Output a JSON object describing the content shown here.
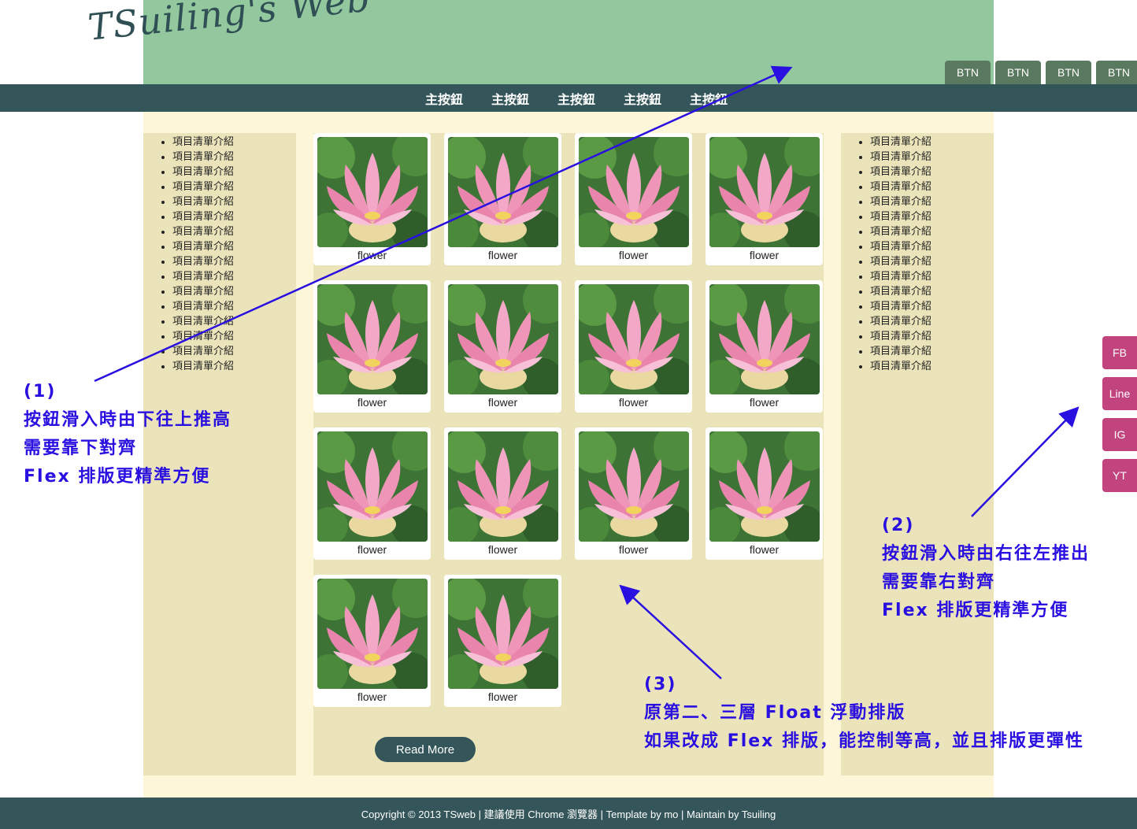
{
  "header": {
    "logo_text": "TSuiling's Web",
    "top_buttons": [
      "BTN",
      "BTN",
      "BTN",
      "BTN"
    ]
  },
  "nav": {
    "items": [
      "主按鈕",
      "主按鈕",
      "主按鈕",
      "主按鈕",
      "主按鈕"
    ]
  },
  "sidebar_left": {
    "items": [
      "項目清單介紹",
      "項目清單介紹",
      "項目清單介紹",
      "項目清單介紹",
      "項目清單介紹",
      "項目清單介紹",
      "項目清單介紹",
      "項目清單介紹",
      "項目清單介紹",
      "項目清單介紹",
      "項目清單介紹",
      "項目清單介紹",
      "項目清單介紹",
      "項目清單介紹",
      "項目清單介紹",
      "項目清單介紹"
    ]
  },
  "sidebar_right": {
    "items": [
      "項目清單介紹",
      "項目清單介紹",
      "項目清單介紹",
      "項目清單介紹",
      "項目清單介紹",
      "項目清單介紹",
      "項目清單介紹",
      "項目清單介紹",
      "項目清單介紹",
      "項目清單介紹",
      "項目清單介紹",
      "項目清單介紹",
      "項目清單介紹",
      "項目清單介紹",
      "項目清單介紹",
      "項目清單介紹"
    ]
  },
  "gallery": {
    "captions": [
      "flower",
      "flower",
      "flower",
      "flower",
      "flower",
      "flower",
      "flower",
      "flower",
      "flower",
      "flower",
      "flower",
      "flower",
      "flower",
      "flower"
    ]
  },
  "read_more_label": "Read More",
  "footer_text": "Copyright © 2013 TSweb | 建議使用 Chrome 瀏覽器 | Template by mo | Maintain by Tsuiling",
  "social": [
    "FB",
    "Line",
    "IG",
    "YT"
  ],
  "annotations": {
    "note1": [
      "(1)",
      "按鈕滑入時由下往上推高",
      "需要靠下對齊",
      "Flex 排版更精準方便"
    ],
    "note2": [
      "(2)",
      "按鈕滑入時由右往左推出",
      "需要靠右對齊",
      "Flex 排版更精準方便"
    ],
    "note3": [
      "(3)",
      "原第二、三層 Float 浮動排版",
      "如果改成 Flex 排版，能控制等高，並且排版更彈性"
    ]
  },
  "colors": {
    "header_bg": "#93c89e",
    "nav_bg": "#34565a",
    "sidebar_bg": "#ebe4bb",
    "social_bg": "#c2447e",
    "annotation": "#2a10e0"
  }
}
